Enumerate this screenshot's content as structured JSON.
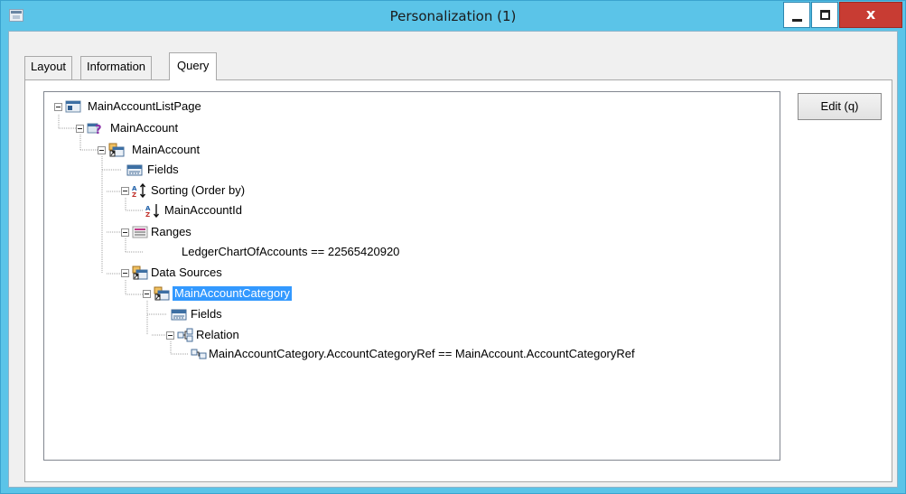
{
  "window": {
    "title": "Personalization (1)",
    "close_glyph": "x"
  },
  "tabs": [
    {
      "label": "Layout",
      "active": false
    },
    {
      "label": "Information",
      "active": false
    },
    {
      "label": "Query",
      "active": true
    }
  ],
  "buttons": {
    "edit": "Edit (q)"
  },
  "tree": {
    "root": "MainAccountListPage",
    "query": "MainAccount",
    "datasource": "MainAccount",
    "fields": "Fields",
    "sorting": "Sorting (Order by)",
    "sort_field": "MainAccountId",
    "ranges": "Ranges",
    "range_value": "LedgerChartOfAccounts == 22565420920",
    "data_sources": "Data Sources",
    "child_datasource": "MainAccountCategory",
    "child_fields": "Fields",
    "relation": "Relation",
    "relation_value": "MainAccountCategory.AccountCategoryRef == MainAccount.AccountCategoryRef"
  },
  "colors": {
    "titlebar": "#5bc4e8",
    "close_button": "#c83c33",
    "selection": "#3399ff"
  },
  "icons": [
    "app-window-icon",
    "minimize-icon",
    "maximize-icon",
    "close-icon",
    "form-icon",
    "query-icon",
    "datasource-icon",
    "fields-icon",
    "sort-icon",
    "sort-desc-icon",
    "ranges-icon",
    "relation-icon"
  ]
}
